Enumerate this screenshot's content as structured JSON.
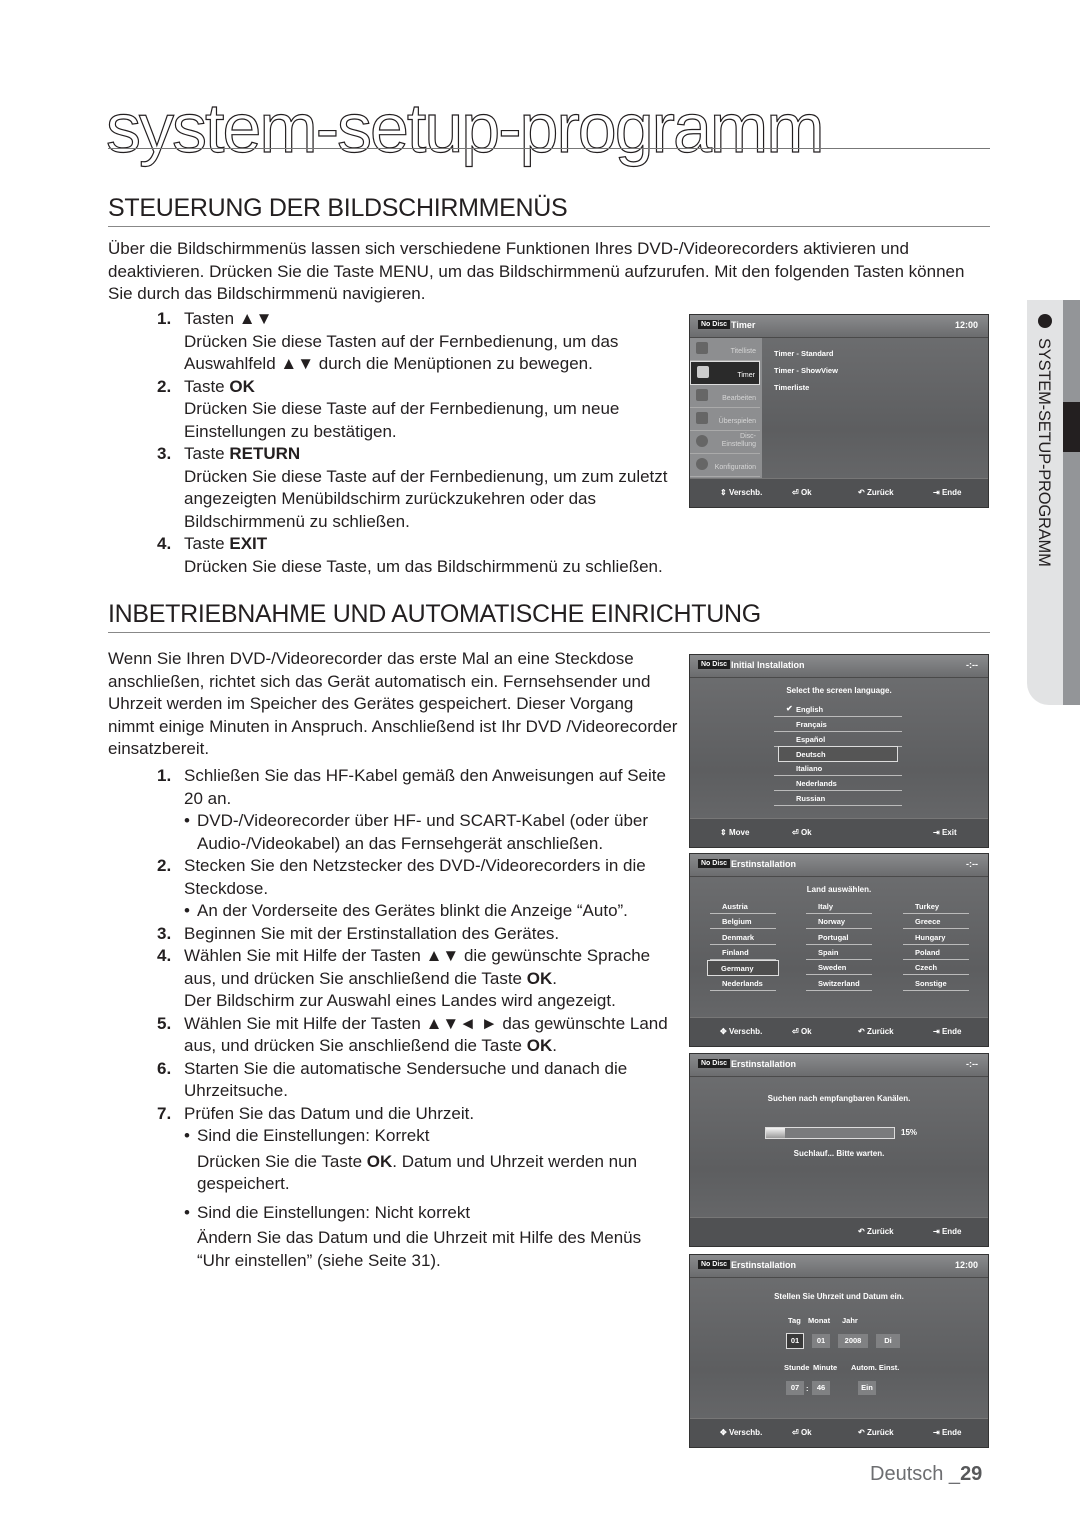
{
  "page": {
    "title": "system-setup-programm",
    "footer": {
      "language": "Deutsch _",
      "page_number": "29"
    },
    "side_tab": "SYSTEM-SETUP-PROGRAMM"
  },
  "section1": {
    "heading": "STEUERUNG DER BILDSCHIRMMENÜS",
    "intro": "Über die Bildschirmmenüs lassen sich verschiedene Funktionen Ihres DVD-/Videorecorders aktivieren und deaktivieren. Drücken Sie die Taste MENU, um das Bildschirmmenü aufzurufen. Mit den folgenden Tasten können Sie durch das Bildschirmmenü navigieren.",
    "items": [
      {
        "num": "1.",
        "title_plain": "Tasten ▲▼",
        "title_bold": "",
        "desc": "Drücken Sie diese Tasten auf der Fernbedienung, um das Auswahlfeld ▲▼ durch die Menüptionen zu bewegen."
      },
      {
        "num": "2.",
        "title_plain": "Taste ",
        "title_bold": "OK",
        "desc": "Drücken Sie diese Taste auf der Fernbedienung, um neue Einstellungen zu bestätigen."
      },
      {
        "num": "3.",
        "title_plain": "Taste ",
        "title_bold": "RETURN",
        "desc": "Drücken Sie diese Taste auf der Fernbedienung, um zum zuletzt angezeigten Menübildschirm zurückzukehren oder das Bildschirmmenü zu schließen."
      },
      {
        "num": "4.",
        "title_plain": "Taste ",
        "title_bold": "EXIT",
        "desc": "Drücken Sie diese Taste, um das Bildschirmmenü zu schließen."
      }
    ]
  },
  "section2": {
    "heading": "INBETRIEBNAHME UND AUTOMATISCHE EINRICHTUNG",
    "intro": "Wenn Sie Ihren DVD-/Videorecorder das erste Mal an eine Steckdose anschließen, richtet sich das Gerät automatisch ein. Fernsehsender und Uhrzeit werden im Speicher des Gerätes gespeichert. Dieser Vorgang nimmt einige Minuten in Anspruch. Anschließend ist Ihr DVD /Videorecorder einsatzbereit.",
    "steps": [
      {
        "num": "1.",
        "text": "Schließen Sie das HF-Kabel gemäß den Anweisungen auf Seite 20 an.",
        "bullet": "DVD-/Videorecorder über HF- und SCART-Kabel (oder über Audio-/Videokabel) an das Fernsehgerät anschließen."
      },
      {
        "num": "2.",
        "text": "Stecken Sie den Netzstecker des DVD-/Videorecorders in die Steckdose.",
        "bullet": "An der Vorderseite des Gerätes blinkt die Anzeige “Auto”."
      },
      {
        "num": "3.",
        "text": "Beginnen Sie mit der Erstinstallation des Gerätes."
      },
      {
        "num": "4.",
        "text": "Wählen Sie mit Hilfe der Tasten ▲▼ die gewünschte Sprache aus, und drücken Sie anschließend die Taste ",
        "bold": "OK",
        "tail": ".",
        "note": "Der Bildschirm zur Auswahl eines Landes wird angezeigt."
      },
      {
        "num": "5.",
        "text": "Wählen Sie mit Hilfe der Tasten ▲▼◄ ► das gewünschte Land aus, und drücken Sie anschließend die Taste ",
        "bold": "OK",
        "tail": "."
      },
      {
        "num": "6.",
        "text": "Starten Sie die automatische Sendersuche und danach die Uhrzeitsuche."
      },
      {
        "num": "7.",
        "text": "Prüfen Sie das Datum und die Uhrzeit."
      }
    ],
    "check_correct": {
      "bullet": "Sind die Einstellungen: Korrekt",
      "pre": "Drücken Sie die Taste ",
      "bold": "OK",
      "post": ". Datum und Uhrzeit werden nun gespeichert."
    },
    "check_incorrect": {
      "bullet": "Sind die Einstellungen: Nicht korrekt",
      "text": "Ändern Sie das Datum und die Uhrzeit mit Hilfe des Menüs “Uhr einstellen” (siehe Seite 31)."
    }
  },
  "screens": {
    "timer": {
      "nodisc": "No Disc",
      "title": "Timer",
      "time": "12:00",
      "menu": [
        "Titelliste",
        "Timer",
        "Bearbeiten",
        "Überspielen",
        "Disc-Einstellung",
        "Konfiguration"
      ],
      "active_menu": "Timer",
      "options": [
        "Timer - Standard",
        "Timer - ShowView",
        "Timerliste"
      ],
      "footer": [
        "Verschb.",
        "Ok",
        "Zurück",
        "Ende"
      ]
    },
    "language": {
      "nodisc": "No Disc",
      "title": "Initial Installation",
      "time": "-:--",
      "prompt": "Select the screen language.",
      "options": [
        "English",
        "Français",
        "Español",
        "Deutsch",
        "Italiano",
        "Nederlands",
        "Russian"
      ],
      "checked": "English",
      "highlighted": "Deutsch",
      "footer": [
        "Move",
        "Ok",
        "Exit"
      ]
    },
    "country": {
      "nodisc": "No Disc",
      "title": "Erstinstallation",
      "time": "-:--",
      "prompt": "Land auswählen.",
      "columns": [
        [
          "Austria",
          "Belgium",
          "Denmark",
          "Finland",
          "Germany",
          "Nederlands"
        ],
        [
          "Italy",
          "Norway",
          "Portugal",
          "Spain",
          "Sweden",
          "Switzerland"
        ],
        [
          "Turkey",
          "Greece",
          "Hungary",
          "Poland",
          "Czech",
          "Sonstige"
        ]
      ],
      "highlighted": "Germany",
      "footer": [
        "Verschb.",
        "Ok",
        "Zurück",
        "Ende"
      ]
    },
    "search": {
      "nodisc": "No Disc",
      "title": "Erstinstallation",
      "time": "-:--",
      "prompt": "Suchen nach empfangbaren Kanälen.",
      "progress_percent": 15,
      "progress_label": "15%",
      "status": "Suchlauf... Bitte warten.",
      "footer": [
        "Zurück",
        "Ende"
      ]
    },
    "clock": {
      "nodisc": "No Disc",
      "title": "Erstinstallation",
      "time": "12:00",
      "prompt": "Stellen Sie Uhrzeit und Datum ein.",
      "date_labels": [
        "Tag",
        "Monat",
        "Jahr"
      ],
      "date_values": [
        "01",
        "01",
        "2008",
        "Di"
      ],
      "time_labels": [
        "Stunde",
        "Minute",
        "Autom. Einst."
      ],
      "time_values": [
        "07",
        "46",
        "Ein"
      ],
      "separator": ":",
      "footer": [
        "Verschb.",
        "Ok",
        "Zurück",
        "Ende"
      ]
    }
  }
}
